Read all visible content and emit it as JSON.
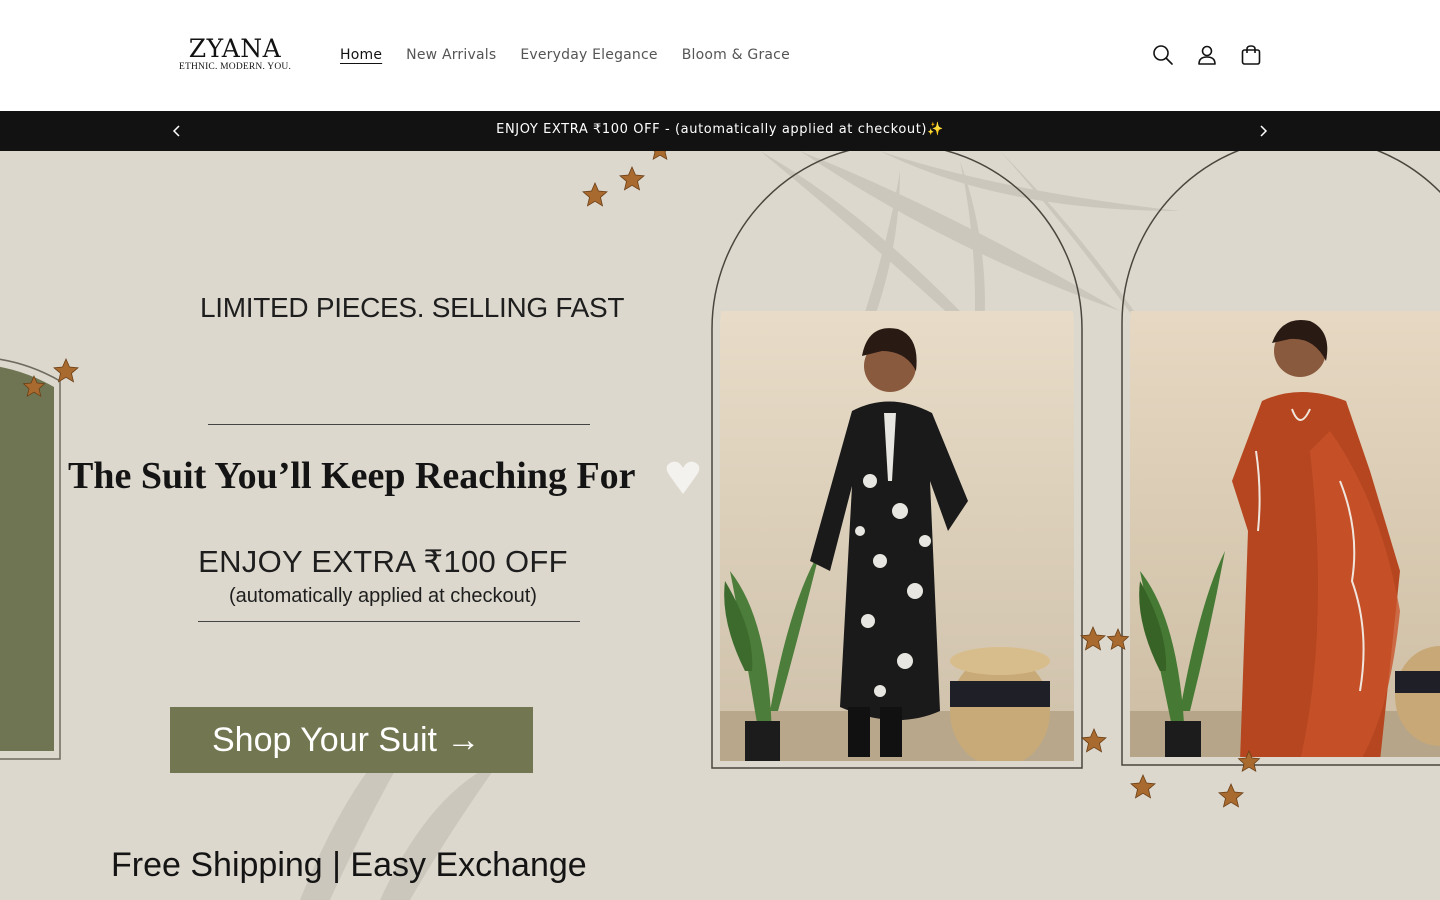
{
  "header": {
    "logo": {
      "name": "ZYANA",
      "tagline": "ETHNIC. MODERN. YOU."
    },
    "nav": [
      {
        "label": "Home",
        "active": true
      },
      {
        "label": "New Arrivals",
        "active": false
      },
      {
        "label": "Everyday Elegance",
        "active": false
      },
      {
        "label": "Bloom & Grace",
        "active": false
      }
    ],
    "icons": [
      "search-icon",
      "account-icon",
      "cart-icon"
    ]
  },
  "announcement": {
    "text": "ENJOY EXTRA ₹100 OFF - (automatically applied at checkout)✨",
    "prev_icon": "chevron-left-icon",
    "next_icon": "chevron-right-icon"
  },
  "hero": {
    "kicker": "LIMITED PIECES. SELLING FAST",
    "title": "The Suit You’ll Keep Reaching For",
    "offer_main": "ENJOY EXTRA ₹100 OFF",
    "offer_sub": "(automatically applied at checkout)",
    "cta_label": "Shop Your Suit →",
    "footer_text": "Free Shipping | Easy Exchange"
  },
  "colors": {
    "announcement_bg": "#121212",
    "hero_bg": "#ddd8ce",
    "cta_bg": "#737751",
    "suit_black": "#1a1a1a",
    "suit_rust": "#b5461f"
  }
}
